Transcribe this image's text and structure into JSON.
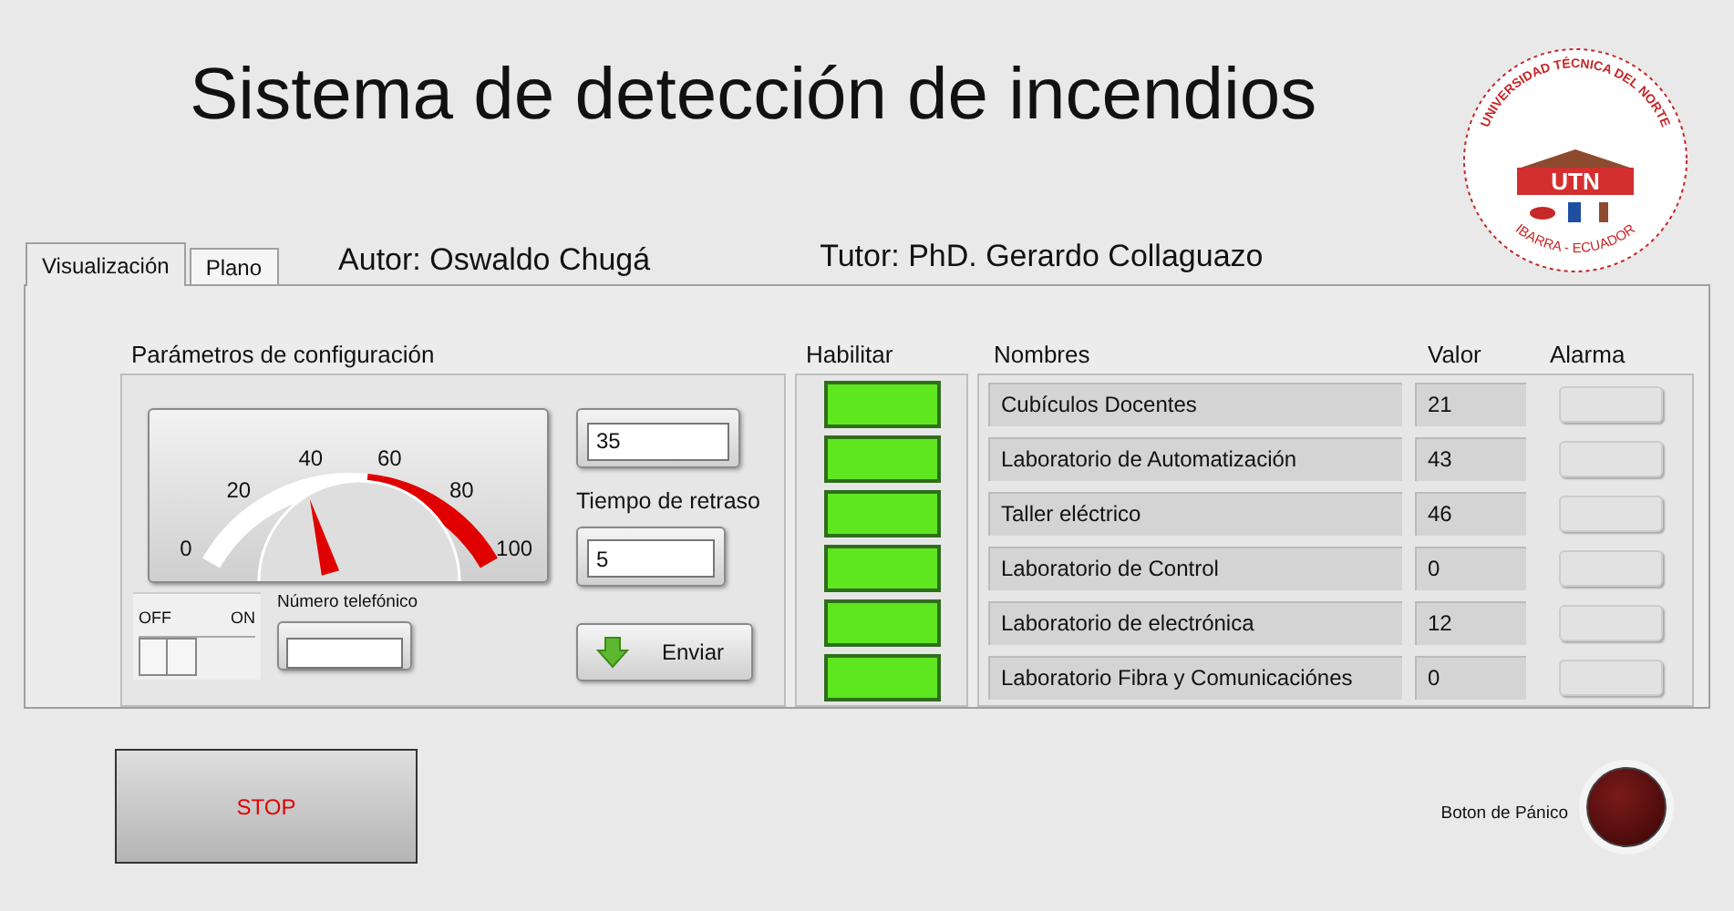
{
  "title": "Sistema de detección de incendios",
  "logo": {
    "ring_text": "UNIVERSIDAD TÉCNICA DEL NORTE",
    "initials": "UTN",
    "city": "IBARRA - ECUADOR"
  },
  "tabs": [
    {
      "label": "Visualización",
      "selected": true
    },
    {
      "label": "Plano",
      "selected": false
    }
  ],
  "author": "Autor: Oswaldo Chugá",
  "tutor": "Tutor: PhD. Gerardo Collaguazo",
  "config": {
    "heading": "Parámetros de configuración",
    "gauge": {
      "level": 0.37,
      "ticks": [
        "0",
        "20",
        "40",
        "60",
        "80",
        "100"
      ]
    },
    "threshold_value": "35",
    "delay_label": "Tiempo de retraso",
    "delay_value": "5",
    "switch": {
      "off_label": "OFF",
      "on_label": "ON",
      "on": false
    },
    "phone_label": "Número telefónico",
    "send_button": "Enviar"
  },
  "zones": {
    "enable_heading": "Habilitar",
    "names_heading": "Nombres",
    "value_heading": "Valor",
    "alarm_heading": "Alarma",
    "rows": [
      {
        "enabled": true,
        "name": "Cubículos Docentes",
        "value": "21",
        "alarm": false
      },
      {
        "enabled": true,
        "name": "Laboratorio de Automatización",
        "value": "43",
        "alarm": false
      },
      {
        "enabled": true,
        "name": "Taller eléctrico",
        "value": "46",
        "alarm": false
      },
      {
        "enabled": true,
        "name": "Laboratorio de Control",
        "value": "0",
        "alarm": false
      },
      {
        "enabled": true,
        "name": "Laboratorio de electrónica",
        "value": "12",
        "alarm": false
      },
      {
        "enabled": true,
        "name": "Laboratorio Fibra y Comunicaciónes",
        "value": "0",
        "alarm": false
      }
    ]
  },
  "stop_button": "STOP",
  "panic_label": "Boton de Pánico"
}
